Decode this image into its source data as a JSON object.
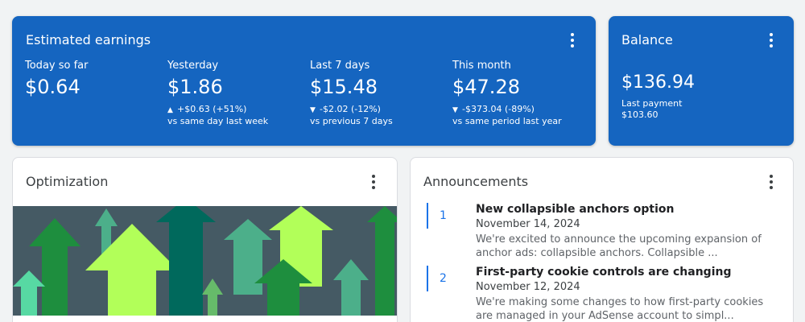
{
  "earnings": {
    "title": "Estimated earnings",
    "metrics": [
      {
        "label": "Today so far",
        "value": "$0.64",
        "change": "",
        "comparison": ""
      },
      {
        "label": "Yesterday",
        "value": "$1.86",
        "change_arrow": "▲",
        "change": "+$0.63 (+51%)",
        "comparison": "vs same day last week"
      },
      {
        "label": "Last 7 days",
        "value": "$15.48",
        "change_arrow": "▼",
        "change": "-$2.02 (-12%)",
        "comparison": "vs previous 7 days"
      },
      {
        "label": "This month",
        "value": "$47.28",
        "change_arrow": "▼",
        "change": "-$373.04 (-89%)",
        "comparison": "vs same period last year"
      }
    ]
  },
  "balance": {
    "title": "Balance",
    "amount": "$136.94",
    "last_payment_label": "Last payment",
    "last_payment_value": "$103.60"
  },
  "optimization": {
    "title": "Optimization"
  },
  "announcements": {
    "title": "Announcements",
    "items": [
      {
        "number": "1",
        "headline": "New collapsible anchors option",
        "date": "November 14, 2024",
        "description": "We're excited to announce the upcoming expansion of anchor ads: collapsible anchors. Collapsible ..."
      },
      {
        "number": "2",
        "headline": "First-party cookie controls are changing",
        "date": "November 12, 2024",
        "description": "We're making some changes to how first-party cookies are managed in your AdSense account to simpl..."
      }
    ]
  },
  "colors": {
    "card_blue": "#1565c0",
    "accent_blue": "#1a73e8",
    "art_background": "#455a64"
  }
}
